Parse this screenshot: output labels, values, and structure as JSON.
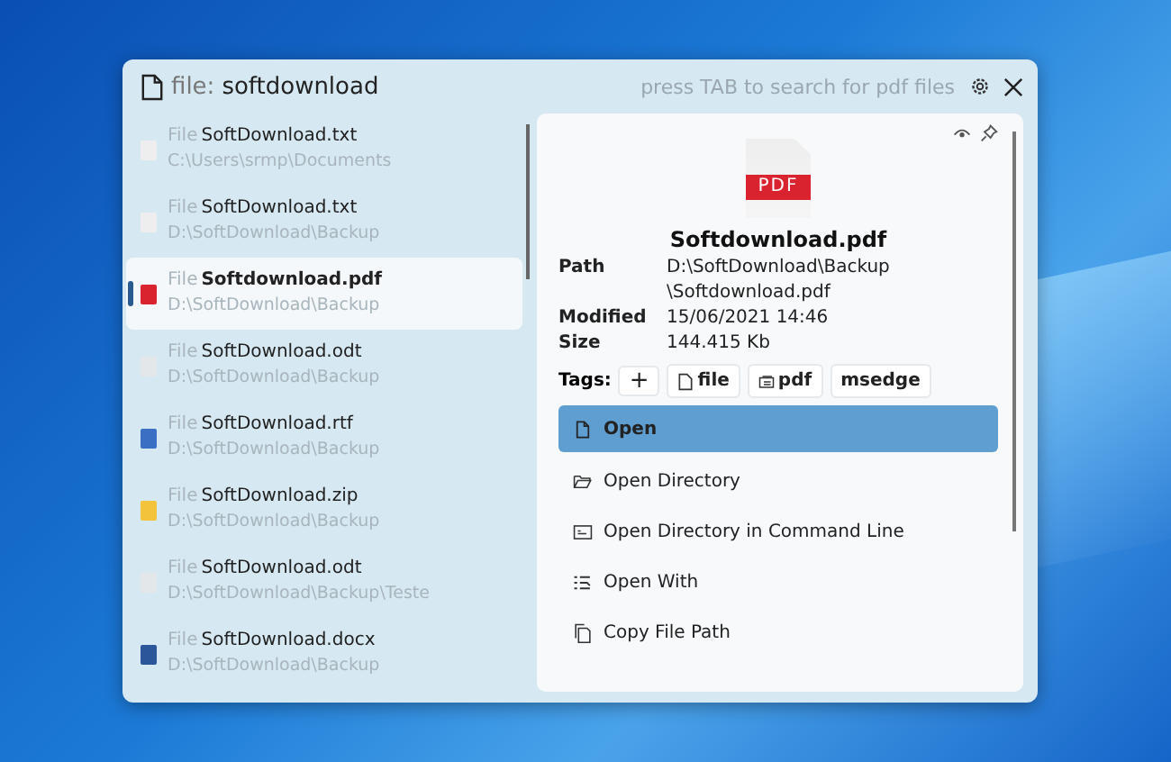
{
  "search": {
    "prefix": "file:",
    "value": "softdownload",
    "hint": "press TAB to search for pdf files"
  },
  "results": [
    {
      "kind": "txt",
      "type": "File",
      "name": "SoftDownload.txt",
      "path": "C:\\Users\\srmp\\Documents",
      "selected": false
    },
    {
      "kind": "txt",
      "type": "File",
      "name": "SoftDownload.txt",
      "path": "D:\\SoftDownload\\Backup",
      "selected": false
    },
    {
      "kind": "pdf",
      "type": "File",
      "name": "Softdownload.pdf",
      "path": "D:\\SoftDownload\\Backup",
      "selected": true
    },
    {
      "kind": "odt",
      "type": "File",
      "name": "SoftDownload.odt",
      "path": "D:\\SoftDownload\\Backup",
      "selected": false
    },
    {
      "kind": "rtf",
      "type": "File",
      "name": "SoftDownload.rtf",
      "path": "D:\\SoftDownload\\Backup",
      "selected": false
    },
    {
      "kind": "zip",
      "type": "File",
      "name": "SoftDownload.zip",
      "path": "D:\\SoftDownload\\Backup",
      "selected": false
    },
    {
      "kind": "odt",
      "type": "File",
      "name": "SoftDownload.odt",
      "path": "D:\\SoftDownload\\Backup\\Teste",
      "selected": false
    },
    {
      "kind": "docx",
      "type": "File",
      "name": "SoftDownload.docx",
      "path": "D:\\SoftDownload\\Backup",
      "selected": false
    }
  ],
  "preview": {
    "badge": "PDF",
    "title": "Softdownload.pdf",
    "details": [
      {
        "label": "Path",
        "lines": [
          "D:\\SoftDownload\\Backup",
          "\\Softdownload.pdf"
        ]
      },
      {
        "label": "Modified",
        "lines": [
          "15/06/2021 14:46"
        ]
      },
      {
        "label": "Size",
        "lines": [
          "144.415 Kb"
        ]
      }
    ],
    "tags_label": "Tags:",
    "add_tag": "+",
    "tags": [
      {
        "kind": "file",
        "label": "file"
      },
      {
        "kind": "pdf",
        "label": "pdf"
      },
      {
        "kind": "plain",
        "label": "msedge"
      }
    ],
    "actions": [
      {
        "kind": "open",
        "label": "Open",
        "selected": true
      },
      {
        "kind": "folder",
        "label": "Open Directory",
        "selected": false
      },
      {
        "kind": "terminal",
        "label": "Open Directory in Command Line",
        "selected": false
      },
      {
        "kind": "list",
        "label": "Open With",
        "selected": false
      },
      {
        "kind": "copy",
        "label": "Copy File Path",
        "selected": false
      }
    ]
  }
}
